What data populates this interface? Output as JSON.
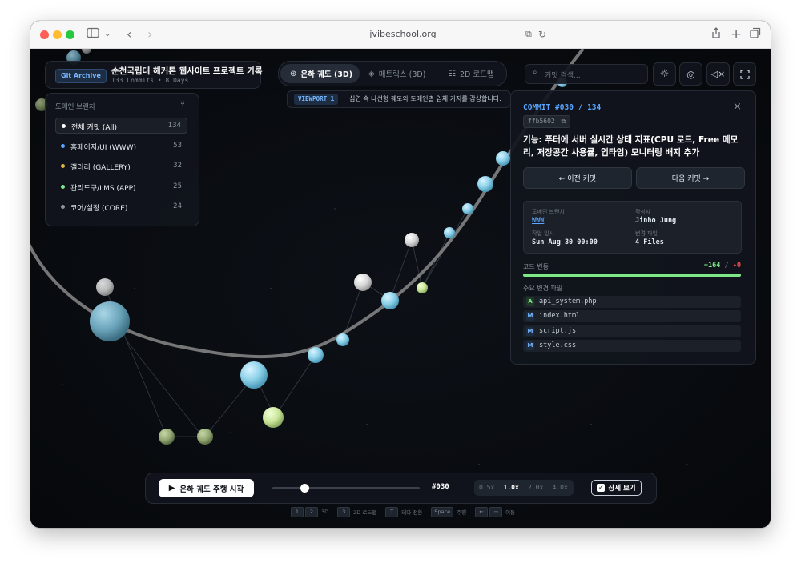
{
  "browser": {
    "url": "jvibeschool.org"
  },
  "header": {
    "badge": "Git Archive",
    "title": "순천국립대 해커톤 웹사이트 프로젝트 기록",
    "subtitle": "133 Commits • 8 Days"
  },
  "views": {
    "tabs": [
      {
        "label": "은하 궤도 (3D)",
        "icon": "galaxy-icon",
        "active": true
      },
      {
        "label": "매트릭스 (3D)",
        "icon": "layers-icon",
        "active": false
      },
      {
        "label": "2D 로드맵",
        "icon": "roadmap-icon",
        "active": false
      }
    ],
    "viewport_badge": "VIEWPORT 1",
    "viewport_desc": "심연 속 나선형 궤도와 도메인별 입체 가지를 감상합니다."
  },
  "search": {
    "placeholder": "커밋 검색..."
  },
  "toolbar_icons": [
    "sun-icon",
    "compass-icon",
    "mute-icon",
    "fullscreen-icon"
  ],
  "branches": {
    "title": "도메인 브랜치",
    "items": [
      {
        "label": "전체 커밋 (All)",
        "count": "134",
        "color": "#ffffff",
        "active": true
      },
      {
        "label": "홈페이지/UI (WWW)",
        "count": "53",
        "color": "#58a6ff",
        "active": false
      },
      {
        "label": "갤러리 (GALLERY)",
        "count": "32",
        "color": "#e3b341",
        "active": false
      },
      {
        "label": "관리도구/LMS (APP)",
        "count": "25",
        "color": "#7ee787",
        "active": false
      },
      {
        "label": "코어/설정 (CORE)",
        "count": "24",
        "color": "#8b949e",
        "active": false
      }
    ]
  },
  "commit": {
    "heading": "COMMIT #030 / 134",
    "hash": "ffb5602",
    "title": "기능: 푸터에 서버 실시간 상태 지표(CPU 로드, Free 메모리, 저장공간 사용률, 업타임) 모니터링 배지 추가",
    "prev_label": "← 이전 커밋",
    "next_label": "다음 커밋 →",
    "meta": {
      "domain_label": "도메인 브랜치",
      "domain_value": "WWW",
      "author_label": "작성자",
      "author_value": "Jinho Jung",
      "date_label": "작업 일시",
      "date_value": "Sun Aug 30 00:00",
      "files_label": "변경 파일",
      "files_value": "4 Files"
    },
    "changes_label": "코드 변동",
    "additions": "+164",
    "sep": "/",
    "deletions": "-0",
    "additions_ratio": 1.0,
    "files_heading": "주요 변경 파일",
    "files": [
      {
        "status": "A",
        "name": "api_system.php"
      },
      {
        "status": "M",
        "name": "index.html"
      },
      {
        "status": "M",
        "name": "script.js"
      },
      {
        "status": "M",
        "name": "style.css"
      }
    ]
  },
  "player": {
    "play_label": "은하 궤도 주행 시작",
    "position": "#030",
    "progress": 0.22,
    "speeds": [
      "0.5x",
      "1.0x",
      "2.0x",
      "4.0x"
    ],
    "active_speed": "1.0x",
    "detail_label": "상세 보기",
    "detail_checked": true
  },
  "shortcuts": [
    {
      "keys": [
        "1",
        "2"
      ],
      "label": "3D"
    },
    {
      "keys": [
        "3"
      ],
      "label": "2D 로드맵"
    },
    {
      "keys": [
        "T"
      ],
      "label": "테마 전환"
    },
    {
      "keys": [
        "Space"
      ],
      "label": "주행"
    },
    {
      "keys": [
        "←",
        "→"
      ],
      "label": "이동"
    }
  ]
}
